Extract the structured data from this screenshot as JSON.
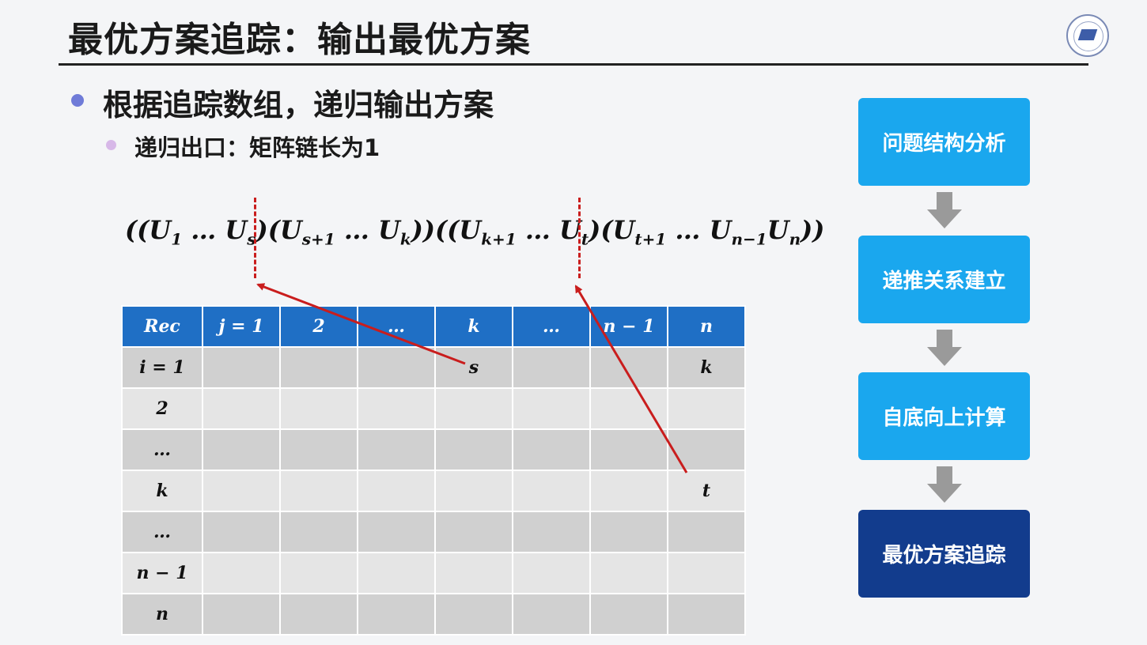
{
  "slide": {
    "title": "最优方案追踪：输出最优方案",
    "bullet_main": "根据追踪数组，递归输出方案",
    "bullet_sub": "递归出口：矩阵链长为1"
  },
  "formula": {
    "open": "((",
    "u1": "U",
    "u1_sub": "1",
    "dots1": " … ",
    "us": "U",
    "us_sub": "s",
    "mid1": ")(",
    "us1": "U",
    "us1_sub": "s+1",
    "dots2": " … ",
    "uk": "U",
    "uk_sub": "k",
    "mid2": "))((",
    "uk1": "U",
    "uk1_sub": "k+1",
    "dots3": " … ",
    "ut": "U",
    "ut_sub": "t",
    "mid3": ")(",
    "ut1": "U",
    "ut1_sub": "t+1",
    "dots4": " … ",
    "un1": "U",
    "un1_sub": "n−1",
    "un": "U",
    "un_sub": "n",
    "close": "))"
  },
  "table": {
    "headers": [
      "Rec",
      "j = 1",
      "2",
      "…",
      "k",
      "…",
      "n − 1",
      "n"
    ],
    "rows": [
      [
        "i = 1",
        "",
        "",
        "",
        "s",
        "",
        "",
        "k"
      ],
      [
        "2",
        "",
        "",
        "",
        "",
        "",
        "",
        ""
      ],
      [
        "…",
        "",
        "",
        "",
        "",
        "",
        "",
        ""
      ],
      [
        "k",
        "",
        "",
        "",
        "",
        "",
        "",
        "t"
      ],
      [
        "…",
        "",
        "",
        "",
        "",
        "",
        "",
        ""
      ],
      [
        "n − 1",
        "",
        "",
        "",
        "",
        "",
        "",
        ""
      ],
      [
        "n",
        "",
        "",
        "",
        "",
        "",
        "",
        ""
      ]
    ]
  },
  "flow": {
    "steps": [
      "问题结构分析",
      "递推关系建立",
      "自底向上计算",
      "最优方案追踪"
    ],
    "current_index": 3
  },
  "colors": {
    "header_blue": "#1f6fc5",
    "flow_light": "#1aa7ee",
    "flow_dark": "#123c8d",
    "arrow_red": "#c91d1d"
  }
}
